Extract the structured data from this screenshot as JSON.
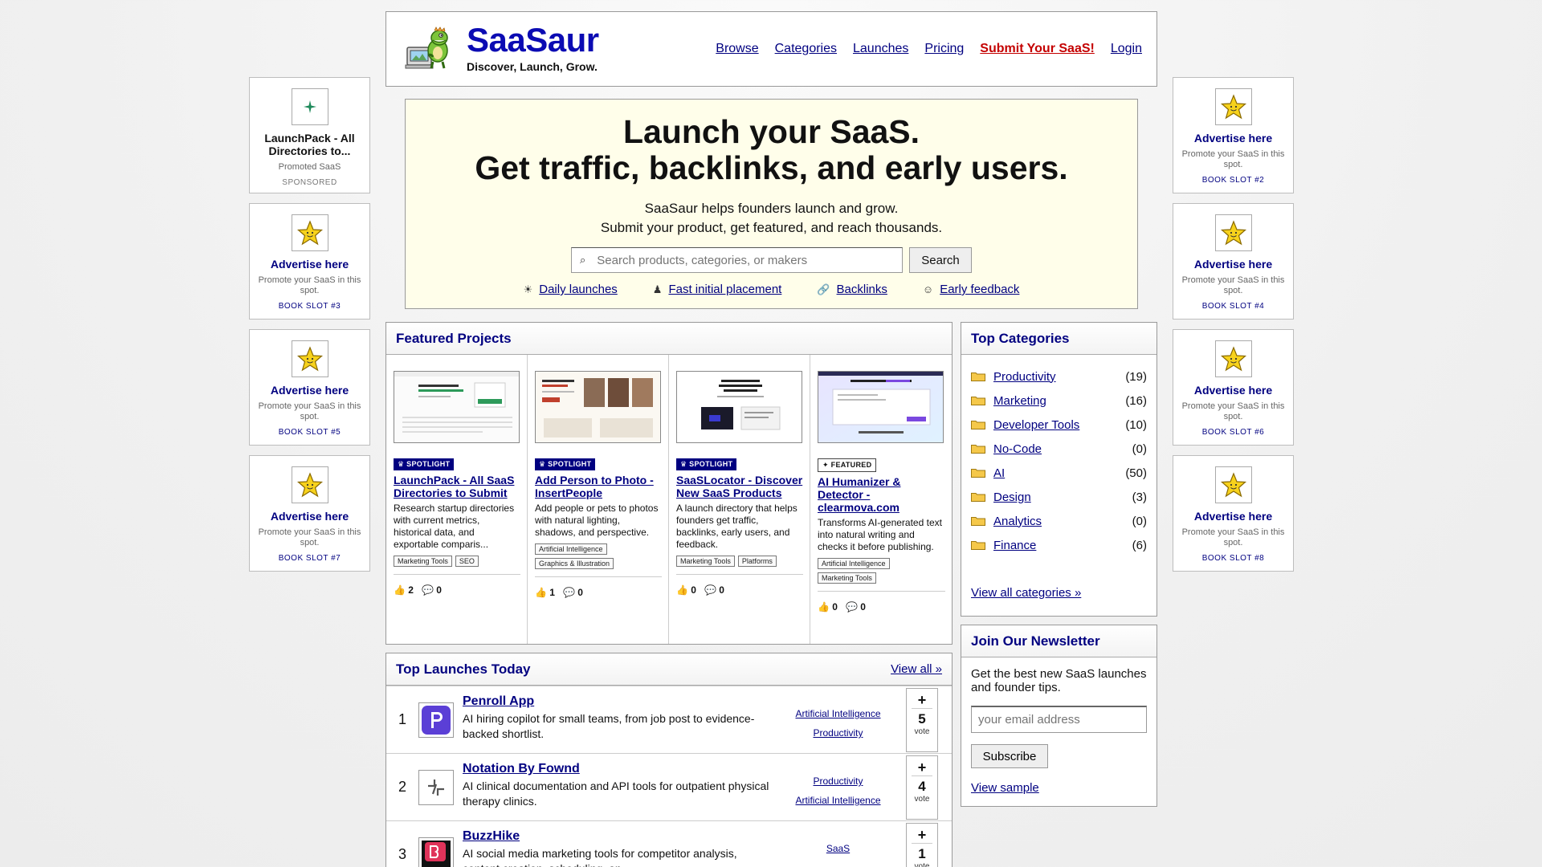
{
  "brand": {
    "name": "SaaSaur",
    "tagline": "Discover, Launch, Grow."
  },
  "nav": [
    "Browse",
    "Categories",
    "Launches",
    "Pricing",
    "Submit Your SaaS!",
    "Login"
  ],
  "left_ads": [
    {
      "title": "LaunchPack - All Directories to...",
      "sub": "Promoted SaaS",
      "slot": "SPONSORED"
    },
    {
      "title": "Advertise here",
      "sub": "Promote your SaaS in this spot.",
      "slot": "BOOK SLOT #3"
    },
    {
      "title": "Advertise here",
      "sub": "Promote your SaaS in this spot.",
      "slot": "BOOK SLOT #5"
    },
    {
      "title": "Advertise here",
      "sub": "Promote your SaaS in this spot.",
      "slot": "BOOK SLOT #7"
    }
  ],
  "right_ads": [
    {
      "title": "Advertise here",
      "sub": "Promote your SaaS in this spot.",
      "slot": "BOOK SLOT #2"
    },
    {
      "title": "Advertise here",
      "sub": "Promote your SaaS in this spot.",
      "slot": "BOOK SLOT #4"
    },
    {
      "title": "Advertise here",
      "sub": "Promote your SaaS in this spot.",
      "slot": "BOOK SLOT #6"
    },
    {
      "title": "Advertise here",
      "sub": "Promote your SaaS in this spot.",
      "slot": "BOOK SLOT #8"
    }
  ],
  "hero": {
    "line1": "Launch your SaaS.",
    "line2": "Get traffic, backlinks, and early users.",
    "desc1": "SaaSaur helps founders launch and grow.",
    "desc2": "Submit your product, get featured, and reach thousands.",
    "search_placeholder": "Search products, categories, or makers",
    "search_button": "Search",
    "features": [
      "Daily launches",
      "Fast initial placement",
      "Backlinks",
      "Early feedback"
    ]
  },
  "featured": {
    "title": "Featured Projects",
    "cards": [
      {
        "badge": "♛ SPOTLIGHT",
        "title": "LaunchPack - All SaaS Directories to Submit",
        "desc": "Research startup directories with current metrics, historical data, and exportable comparis...",
        "tags": [
          "Marketing Tools",
          "SEO"
        ],
        "upvotes": "2",
        "comments": "0"
      },
      {
        "badge": "♛ SPOTLIGHT",
        "title": "Add Person to Photo - InsertPeople",
        "desc": "Add people or pets to photos with natural lighting, shadows, and perspective.",
        "tags": [
          "Artificial Intelligence",
          "Graphics & Illustration"
        ],
        "upvotes": "1",
        "comments": "0"
      },
      {
        "badge": "♛ SPOTLIGHT",
        "title": "SaaSLocator - Discover New SaaS Products",
        "desc": "A launch directory that helps founders get traffic, backlinks, early users, and feedback.",
        "tags": [
          "Marketing Tools",
          "Platforms"
        ],
        "upvotes": "0",
        "comments": "0"
      },
      {
        "badge": "✦ FEATURED",
        "title": "AI Humanizer & Detector - clearmova.com",
        "desc": "Transforms AI-generated text into natural writing and checks it before publishing.",
        "tags": [
          "Artificial Intelligence",
          "Marketing Tools"
        ],
        "upvotes": "0",
        "comments": "0"
      }
    ]
  },
  "launches": {
    "title": "Top Launches Today",
    "view_all": "View all »",
    "vote_label": "vote",
    "items": [
      {
        "rank": "1",
        "name": "Penroll App",
        "desc": "AI hiring copilot for small teams, from job post to evidence-backed shortlist.",
        "cats": [
          "Artificial Intelligence",
          "Productivity"
        ],
        "votes": "5"
      },
      {
        "rank": "2",
        "name": "Notation By Fownd",
        "desc": "AI clinical documentation and API tools for outpatient physical therapy clinics.",
        "cats": [
          "Productivity",
          "Artificial Intelligence"
        ],
        "votes": "4"
      },
      {
        "rank": "3",
        "name": "BuzzHike",
        "desc": "AI social media marketing tools for competitor analysis, content creation, scheduling, an...",
        "cats": [
          "SaaS"
        ],
        "votes": "1"
      }
    ]
  },
  "categories": {
    "title": "Top Categories",
    "items": [
      {
        "name": "Productivity",
        "count": "(19)"
      },
      {
        "name": "Marketing",
        "count": "(16)"
      },
      {
        "name": "Developer Tools",
        "count": "(10)"
      },
      {
        "name": "No-Code",
        "count": "(0)"
      },
      {
        "name": "AI",
        "count": "(50)"
      },
      {
        "name": "Design",
        "count": "(3)"
      },
      {
        "name": "Analytics",
        "count": "(0)"
      },
      {
        "name": "Finance",
        "count": "(6)"
      }
    ],
    "view_all": "View all categories »"
  },
  "newsletter": {
    "title": "Join Our Newsletter",
    "desc": "Get the best new SaaS launches and founder tips.",
    "placeholder": "your email address",
    "button": "Subscribe",
    "sample": "View sample"
  },
  "colors": {
    "link": "#000080",
    "brand": "#0b0bb3",
    "submit": "#c40000",
    "hero_bg": "#fffeea"
  }
}
